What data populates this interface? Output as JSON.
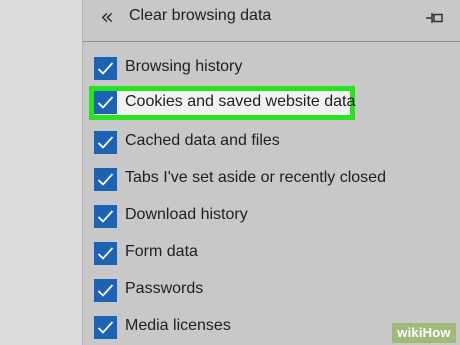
{
  "header": {
    "back_icon": "double-chevron-left-icon",
    "back_glyph": "«",
    "title": "Clear browsing data",
    "pin_icon": "pin-icon"
  },
  "options": [
    {
      "label": "Browsing history",
      "checked": true
    },
    {
      "label": "Cookies and saved website data",
      "checked": true,
      "highlighted": true
    },
    {
      "label": "Cached data and files",
      "checked": true
    },
    {
      "label": "Tabs I've set aside or recently closed",
      "checked": true
    },
    {
      "label": "Download history",
      "checked": true
    },
    {
      "label": "Form data",
      "checked": true
    },
    {
      "label": "Passwords",
      "checked": true
    },
    {
      "label": "Media licenses",
      "checked": true
    }
  ],
  "colors": {
    "checkbox": "#1a63b5",
    "highlight_border": "#28e31f",
    "panel_bg": "#c8c8c8"
  },
  "watermark": {
    "text": "wikiHow"
  }
}
